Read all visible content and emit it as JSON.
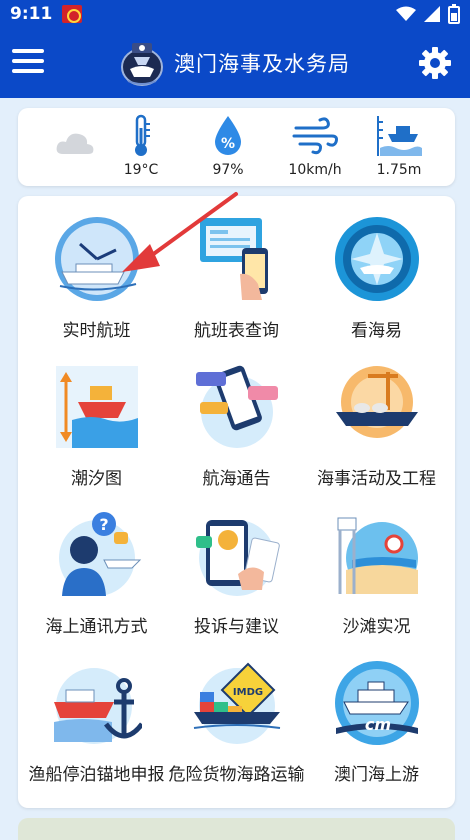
{
  "status_bar": {
    "time": "9:11"
  },
  "app_bar": {
    "title": "澳门海事及水务局"
  },
  "weather": [
    {
      "name": "cloud-icon",
      "value": ""
    },
    {
      "name": "thermometer-icon",
      "value": "19°C"
    },
    {
      "name": "humidity-icon",
      "value": "97%"
    },
    {
      "name": "wind-icon",
      "value": "10km/h"
    },
    {
      "name": "tide-icon",
      "value": "1.75m"
    }
  ],
  "tiles": [
    {
      "label": "实时航班"
    },
    {
      "label": "航班表查询"
    },
    {
      "label": "看海易"
    },
    {
      "label": "潮汐图"
    },
    {
      "label": "航海通告"
    },
    {
      "label": "海事活动及工程"
    },
    {
      "label": "海上通讯方式"
    },
    {
      "label": "投诉与建议"
    },
    {
      "label": "沙滩实况"
    },
    {
      "label": "渔船停泊锚地申报"
    },
    {
      "label": "危险货物海路运输"
    },
    {
      "label": "澳门海上游"
    }
  ],
  "badge": {
    "imdg": "IMDG",
    "cm": "cm"
  },
  "colors": {
    "primary": "#0b49c8",
    "accent": "#1a8fe3",
    "arrow": "#e23a3a"
  }
}
